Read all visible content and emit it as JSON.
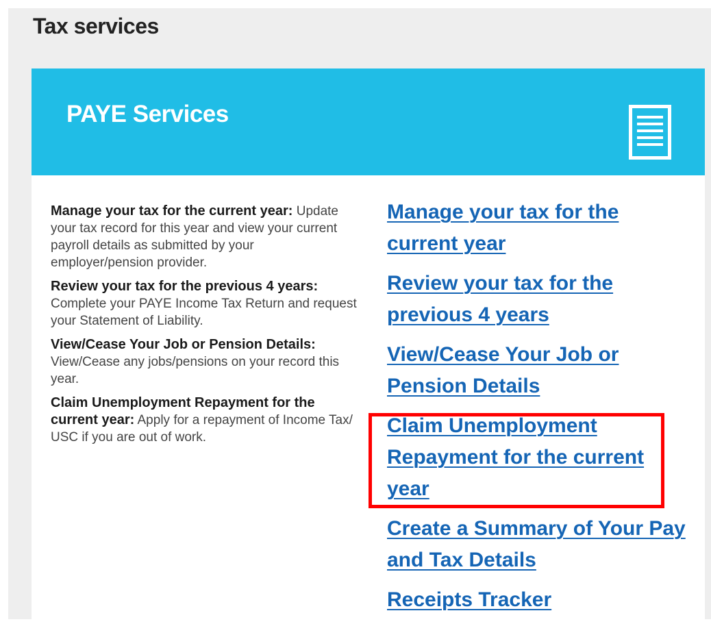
{
  "page": {
    "title": "Tax services"
  },
  "card": {
    "title": "PAYE Services",
    "icon": "document-icon",
    "header_color": "#20bde6"
  },
  "descriptions": [
    {
      "heading": "Manage your tax for the current year:",
      "text": " Update your tax record for this year and view your current payroll details as submitted by your employer/pension provider."
    },
    {
      "heading": "Review your tax for the previous 4 years:",
      "text": " Complete your PAYE Income Tax Return and request your Statement of Liability."
    },
    {
      "heading": "View/Cease Your Job or Pension Details:",
      "text": " View/Cease any jobs/pensions on your record this year."
    },
    {
      "heading": "Claim Unemployment Repayment for the current year:",
      "text": " Apply for a repayment of Income Tax/ USC if you are out of work."
    }
  ],
  "links": [
    {
      "label": "Manage your tax for the current year"
    },
    {
      "label": "Review your tax for the previous 4 years"
    },
    {
      "label": "View/Cease Your Job or Pension Details"
    },
    {
      "label": "Claim Unemployment Repayment for the current year"
    },
    {
      "label": "Create a Summary of Your Pay and Tax Details"
    },
    {
      "label": "Receipts Tracker"
    }
  ],
  "colors": {
    "link": "#1565b5",
    "highlight": "#ff0000"
  }
}
